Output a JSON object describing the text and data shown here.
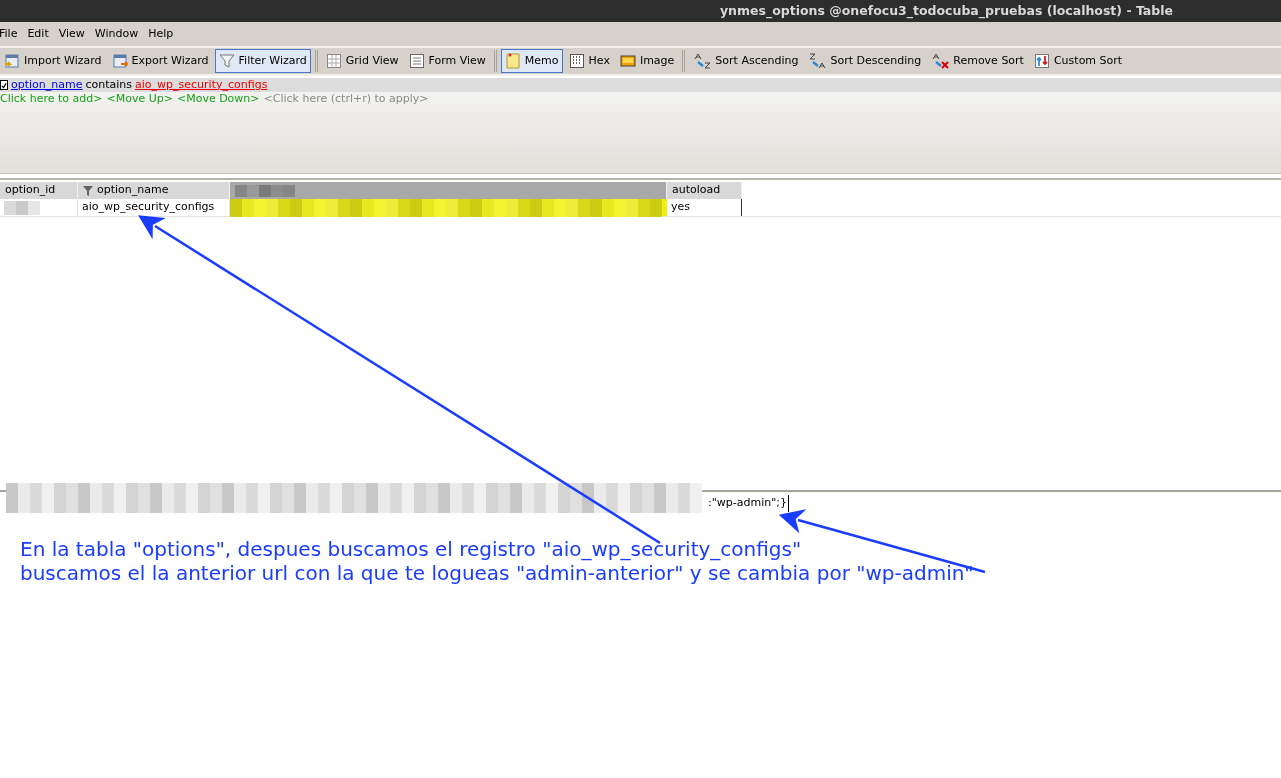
{
  "window": {
    "title": "ynmes_options @onefocu3_todocuba_pruebas (localhost) - Table"
  },
  "menu": [
    "File",
    "Edit",
    "View",
    "Window",
    "Help"
  ],
  "toolbar": {
    "groups": [
      [
        {
          "label": "Import Wizard",
          "selected": false
        },
        {
          "label": "Export Wizard",
          "selected": false
        },
        {
          "label": "Filter Wizard",
          "selected": true
        }
      ],
      [
        {
          "label": "Grid View",
          "selected": false
        },
        {
          "label": "Form View",
          "selected": false
        }
      ],
      [
        {
          "label": "Memo",
          "selected": true
        },
        {
          "label": "Hex",
          "selected": false
        },
        {
          "label": "Image",
          "selected": false
        }
      ],
      [
        {
          "label": "Sort Ascending",
          "selected": false
        },
        {
          "label": "Sort Descending",
          "selected": false
        },
        {
          "label": "Remove Sort",
          "selected": false
        },
        {
          "label": "Custom Sort",
          "selected": false
        }
      ]
    ]
  },
  "filter": {
    "checked": true,
    "field": "option_name",
    "operator": "contains",
    "value": "aio_wp_security_configs",
    "actions": [
      {
        "label": "Click here to add>",
        "kind": "action"
      },
      {
        "label": "<Move Up>",
        "kind": "action"
      },
      {
        "label": "<Move Down>",
        "kind": "action"
      },
      {
        "label": "<Click here (ctrl+r) to apply>",
        "kind": "hint"
      }
    ]
  },
  "table": {
    "columns": [
      {
        "label": "option_id",
        "filtered": false
      },
      {
        "label": "option_name",
        "filtered": true
      },
      {
        "filtered": false
      },
      {
        "label": "autoload",
        "filtered": false
      }
    ],
    "rows": [
      {
        "option_name": "aio_wp_security_configs",
        "autoload": "yes"
      }
    ]
  },
  "memo": {
    "text": ":\"wp-admin\";}"
  },
  "annotation": {
    "lines": [
      "En la tabla \"options\", despues buscamos el registro \"aio_wp_security_configs\"",
      "buscamos el la anterior url con la que te logueas \"admin-anterior\" y se cambia por \"wp-admin\""
    ]
  }
}
